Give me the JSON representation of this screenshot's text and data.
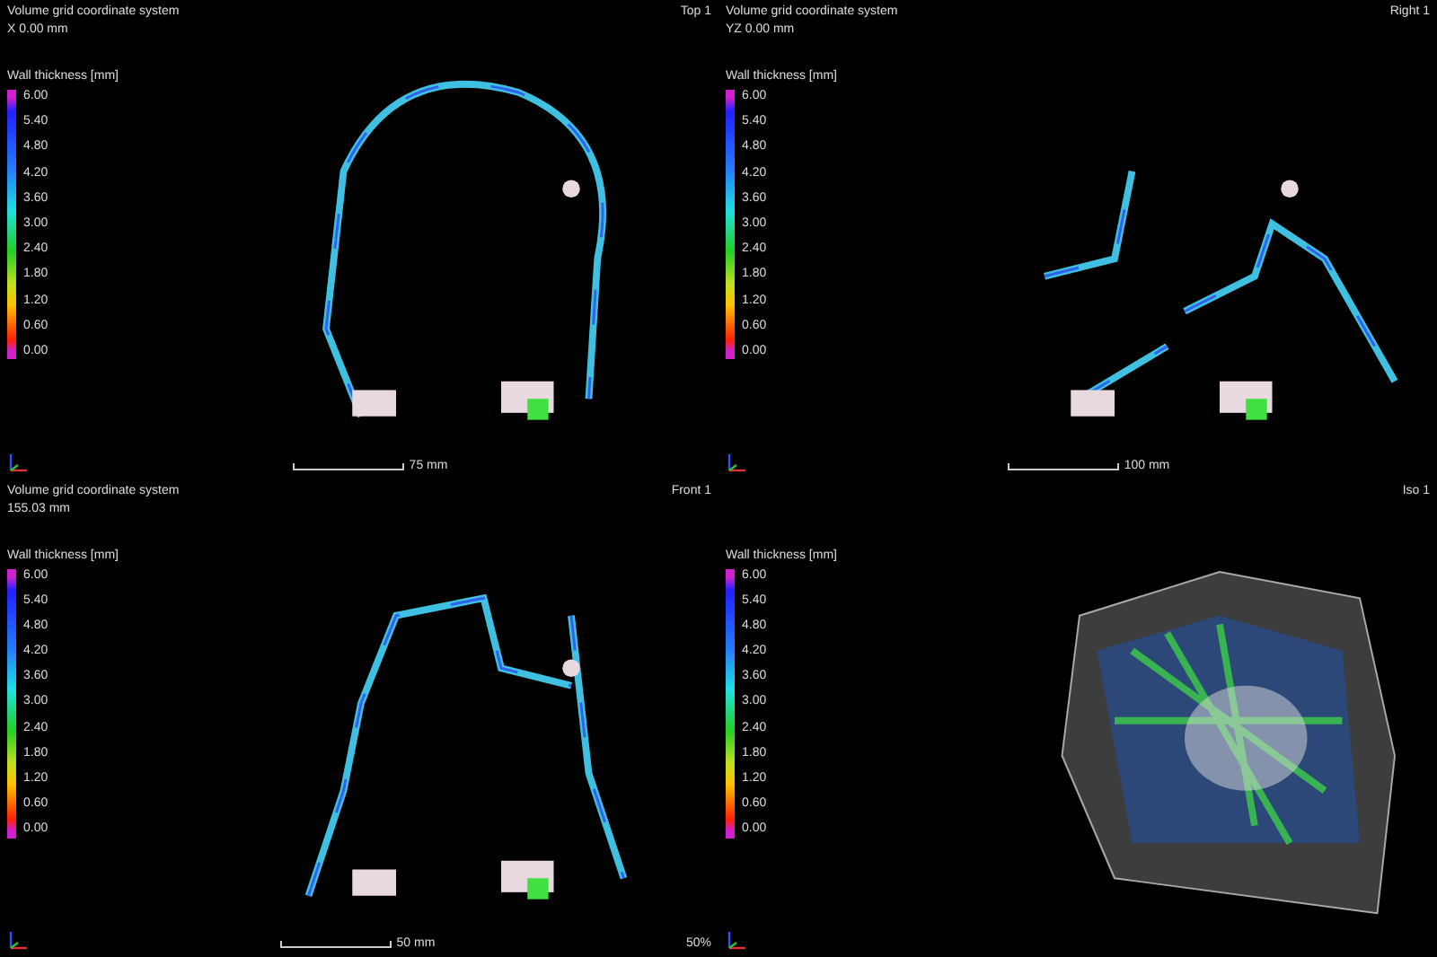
{
  "panels": [
    {
      "kind": "section",
      "title": "Volume grid coordinate system",
      "subtitle": "X 0.00 mm",
      "view_label": "Top 1",
      "legend": {
        "title": "Wall thickness [mm]",
        "ticks": [
          "6.00",
          "5.40",
          "4.80",
          "4.20",
          "3.60",
          "3.00",
          "2.40",
          "1.80",
          "1.20",
          "0.60",
          "0.00"
        ]
      },
      "scale_label": "75 mm"
    },
    {
      "kind": "section",
      "title": "Volume grid coordinate system",
      "subtitle": "YZ 0.00 mm",
      "view_label": "Right 1",
      "legend": {
        "title": "Wall thickness [mm]",
        "ticks": [
          "6.00",
          "5.40",
          "4.80",
          "4.20",
          "3.60",
          "3.00",
          "2.40",
          "1.80",
          "1.20",
          "0.60",
          "0.00"
        ]
      },
      "scale_label": "100 mm"
    },
    {
      "kind": "section",
      "title": "Volume grid coordinate system",
      "subtitle": "155.03 mm",
      "view_label": "Front 1",
      "legend": {
        "title": "Wall thickness [mm]",
        "ticks": [
          "6.00",
          "5.40",
          "4.80",
          "4.20",
          "3.60",
          "3.00",
          "2.40",
          "1.80",
          "1.20",
          "0.60",
          "0.00"
        ]
      },
      "scale_label": "50 mm",
      "footer_label": "50%"
    },
    {
      "kind": "volume",
      "view_label": "Iso 1",
      "legend": {
        "title": "Wall thickness [mm]",
        "ticks": [
          "6.00",
          "5.40",
          "4.80",
          "4.20",
          "3.60",
          "3.00",
          "2.40",
          "1.80",
          "1.20",
          "0.60",
          "0.00"
        ]
      }
    }
  ]
}
